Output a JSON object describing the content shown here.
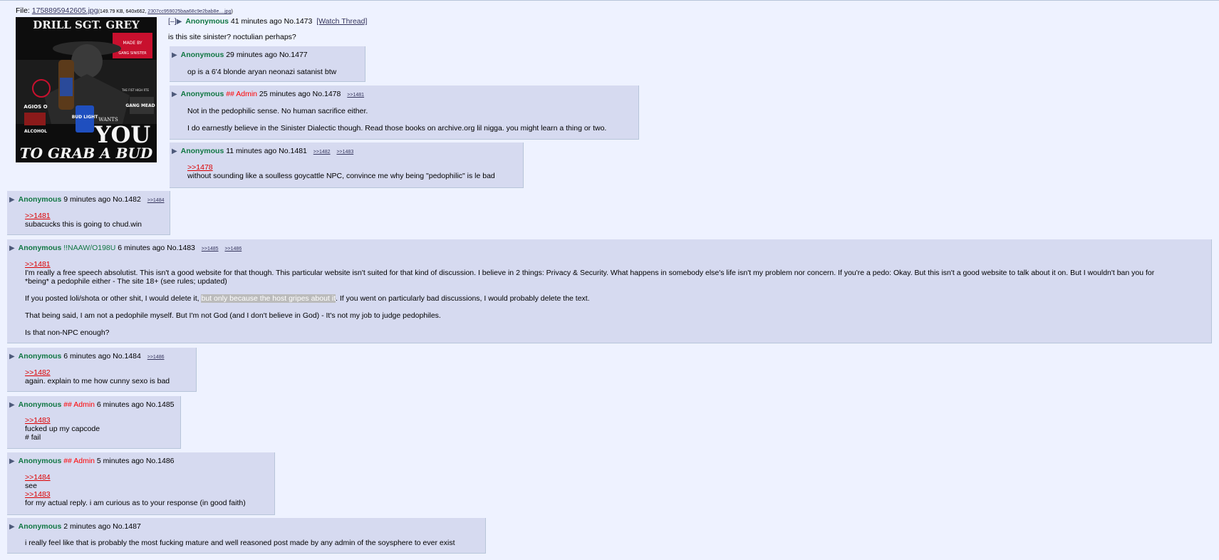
{
  "file": {
    "label": "File:",
    "filename": "1758895942605.jpg",
    "meta_pre": "(149.79 KB, 640x662, ",
    "orig_name": "2307cc959025baa68c9e2bab8e....jpg",
    "meta_post": ")"
  },
  "image": {
    "top_text": "DRILL SGT. GREY",
    "made_by": "MADE BY",
    "gang": "GANG SINISTER",
    "fist": "THE FIST HIGH RTE",
    "agios": "AGIOS O",
    "gang_mead": "GANG MEAD",
    "alcohol": "ALCOHOL",
    "wants": "WANTS",
    "you": "YOU",
    "grab": "TO GRAB A BUD",
    "bud": "BUD LIGHT"
  },
  "op": {
    "collapse": "[–]",
    "name": "Anonymous",
    "time": "41 minutes ago",
    "no": "No.1473",
    "watch": "[Watch Thread]",
    "text": "is this site sinister? noctulian perhaps?"
  },
  "posts": [
    {
      "name": "Anonymous",
      "time": "29 minutes ago",
      "no": "No.1477",
      "lines": [
        "op is a 6'4 blonde aryan neonazi satanist btw"
      ]
    },
    {
      "name": "Anonymous",
      "cap": "## Admin",
      "time": "25 minutes ago",
      "no": "No.1478",
      "backlinks": [
        ">>1481"
      ],
      "lines": [
        "Not in the pedophilic sense. No human sacrifice either.",
        "I do earnestly believe in the Sinister Dialectic though. Read those books on archive.org lil nigga. you might learn a thing or two."
      ]
    },
    {
      "name": "Anonymous",
      "time": "11 minutes ago",
      "no": "No.1481",
      "backlinks": [
        ">>1482",
        ">>1483"
      ],
      "quote": ">>1478",
      "lines": [
        "without sounding like a soulless goycattle NPC, convince me why being \"pedophilic\" is le bad"
      ]
    },
    {
      "name": "Anonymous",
      "time": "9 minutes ago",
      "no": "No.1482",
      "backlinks": [
        ">>1484"
      ],
      "quote": ">>1481",
      "lines": [
        "subacucks this is going to chud.win"
      ]
    },
    {
      "name": "Anonymous",
      "trip": "!!NAAW/O198U",
      "time": "6 minutes ago",
      "no": "No.1483",
      "backlinks": [
        ">>1485",
        ">>1486"
      ],
      "quote": ">>1481",
      "p1": "I'm really a free speech absolutist. This isn't a good website for that though. This particular website isn't suited for that kind of discussion. I believe in 2 things: Privacy & Security. What happens in somebody else's life isn't my problem nor concern. If you're a pedo: Okay. But this isn't a good website to talk about it on. But I wouldn't ban you for",
      "p1b": "*being* a pedophile either - The site 18+ (see rules; updated)",
      "p2a": "If you posted loli/shota or other shit, I would delete it, ",
      "p2hl": "but only because the host gripes about it",
      "p2b": ". If you went on particularly bad discussions, I would probably delete the text.",
      "p3": "That being said, I am not a pedophile myself. But I'm not God (and I don't believe in God) - It's not my job to judge pedophiles.",
      "p4": "Is that non-NPC enough?"
    },
    {
      "name": "Anonymous",
      "time": "6 minutes ago",
      "no": "No.1484",
      "backlinks": [
        ">>1486"
      ],
      "quote": ">>1482",
      "lines": [
        "again. explain to me how cunny sexo is bad"
      ]
    },
    {
      "name": "Anonymous",
      "cap": "## Admin",
      "time": "6 minutes ago",
      "no": "No.1485",
      "quote": ">>1483",
      "lines": [
        "fucked up my capcode",
        "# fail"
      ]
    },
    {
      "name": "Anonymous",
      "cap": "## Admin",
      "time": "5 minutes ago",
      "no": "No.1486",
      "quote": ">>1484",
      "line1": "see",
      "quote2": ">>1483",
      "line2": "for my actual reply. i am curious as to your response (in good faith)"
    },
    {
      "name": "Anonymous",
      "time": "2 minutes ago",
      "no": "No.1487",
      "lines": [
        "i really feel like that is probably the most fucking mature and well reasoned post made by any admin of the soysphere to ever exist"
      ]
    }
  ],
  "colors": {
    "background": "#eef2ff",
    "reply_bg": "#d6daf0",
    "name": "#117743",
    "capcode": "#ff0000",
    "quote": "#dd0000",
    "link": "#34345c"
  }
}
